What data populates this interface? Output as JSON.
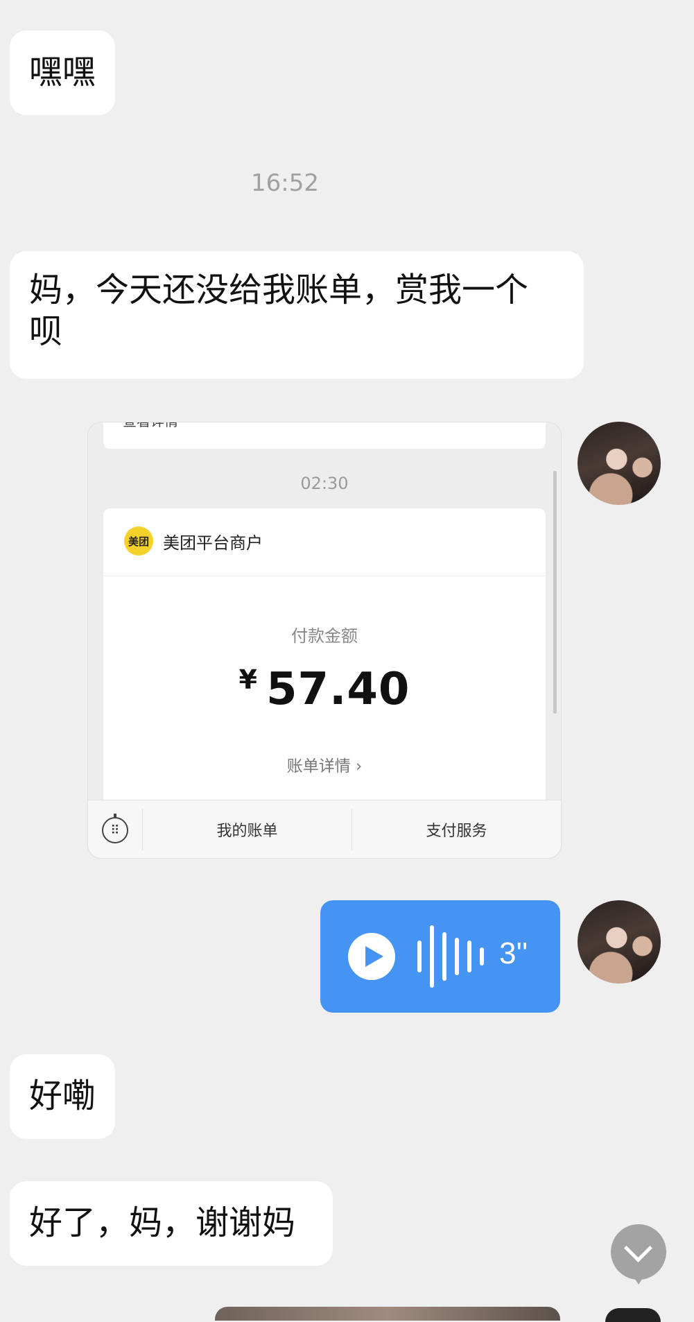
{
  "messages": {
    "m1": "嘿嘿",
    "m2_line1": "妈，今天还没给我账单，赏我一个",
    "m2_line2": "呗",
    "m3": "好嘞",
    "m4": "好了，妈，谢谢妈"
  },
  "timestamp": "16:52",
  "screenshot": {
    "prev_text": "查看详情",
    "time": "02:30",
    "merchant_logo_text": "美团",
    "merchant": "美团平台商户",
    "pay_label": "付款金额",
    "currency": "¥",
    "amount": "57.40",
    "detail_link": "账单详情 ›",
    "bottom_menu": [
      "我的账单",
      "支付服务"
    ]
  },
  "voice": {
    "duration": "3''"
  },
  "icons": {
    "keyboard": "keyboard-icon",
    "play": "play-icon",
    "scroll": "chevron-down-icon"
  },
  "colors": {
    "voice_bubble": "#4594f4",
    "meituan_yellow": "#f5d22b"
  }
}
